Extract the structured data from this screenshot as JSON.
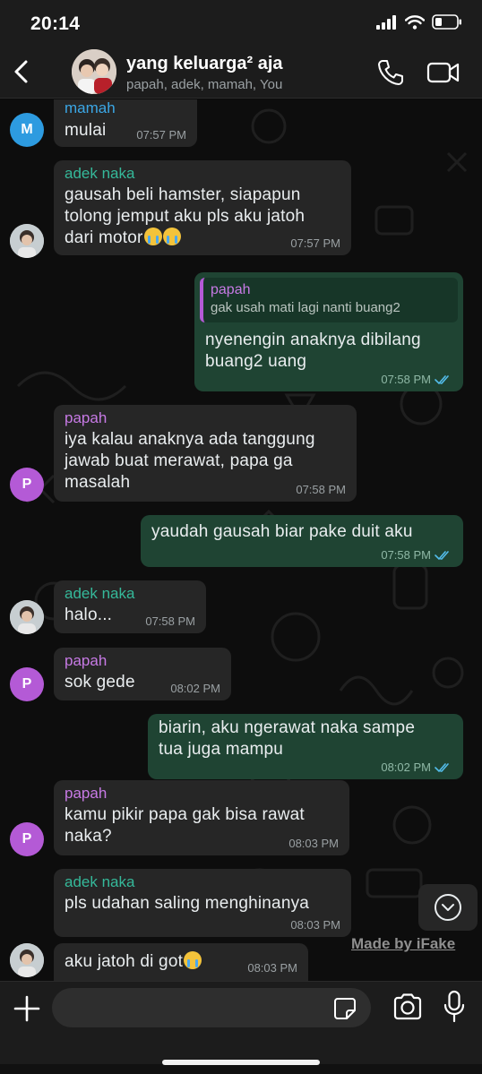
{
  "status_bar": {
    "time": "20:14"
  },
  "header": {
    "title": "yang keluarga² aja",
    "subtitle": "papah, adek, mamah, You"
  },
  "messages": [
    {
      "sender": "mamah",
      "text": "mulai",
      "time": "07:57 PM",
      "direction": "in"
    },
    {
      "sender": "adek naka",
      "lines": [
        "gausah beli hamster, siapapun",
        "tolong jemput aku pls aku jatoh",
        "dari motor"
      ],
      "emoji": "loudly-crying-face x2",
      "time": "07:57 PM",
      "direction": "in"
    },
    {
      "direction": "out",
      "quote_sender": "papah",
      "quote_text": "gak usah mati lagi nanti buang2",
      "lines": [
        "nyenengin anaknya dibilang",
        "buang2 uang"
      ],
      "time": "07:58 PM",
      "status": "read"
    },
    {
      "sender": "papah",
      "lines": [
        "iya kalau anaknya ada tanggung",
        "jawab buat merawat, papa ga",
        "masalah"
      ],
      "time": "07:58 PM",
      "direction": "in"
    },
    {
      "direction": "out",
      "text": "yaudah gausah biar pake duit aku",
      "time": "07:58 PM",
      "status": "read"
    },
    {
      "sender": "adek naka",
      "text": "halo...",
      "time": "07:58 PM",
      "direction": "in"
    },
    {
      "sender": "papah",
      "text": "sok gede",
      "time": "08:02 PM",
      "direction": "in"
    },
    {
      "direction": "out",
      "lines": [
        "biarin, aku ngerawat naka sampe",
        "tua juga mampu"
      ],
      "time": "08:02 PM",
      "status": "read"
    },
    {
      "sender": "papah",
      "lines": [
        "kamu pikir papa gak bisa rawat",
        "naka?"
      ],
      "time": "08:03 PM",
      "direction": "in"
    },
    {
      "sender": "adek naka",
      "text": "pls udahan saling menghinanya",
      "time": "08:03 PM",
      "direction": "in"
    },
    {
      "text": "aku jatoh di got",
      "emoji": "loudly-crying-face",
      "time": "08:03 PM",
      "direction": "in"
    }
  ],
  "avatars": {
    "mamah": "M",
    "papah": "P"
  },
  "watermark": "Made by iFake",
  "input": {
    "placeholder": ""
  },
  "colors": {
    "incoming_bubble": "#262626",
    "outgoing_bubble": "#1f4433",
    "sender_adek": "#35b99a",
    "sender_mamah": "#3ba7e6",
    "sender_papah": "#c77ae5",
    "read_ticks": "#53bdeb"
  },
  "icons": [
    "back-chevron-icon",
    "phone-icon",
    "video-camera-icon",
    "chevron-down-icon",
    "plus-icon",
    "sticker-icon",
    "camera-icon",
    "microphone-icon",
    "double-check-icon"
  ]
}
